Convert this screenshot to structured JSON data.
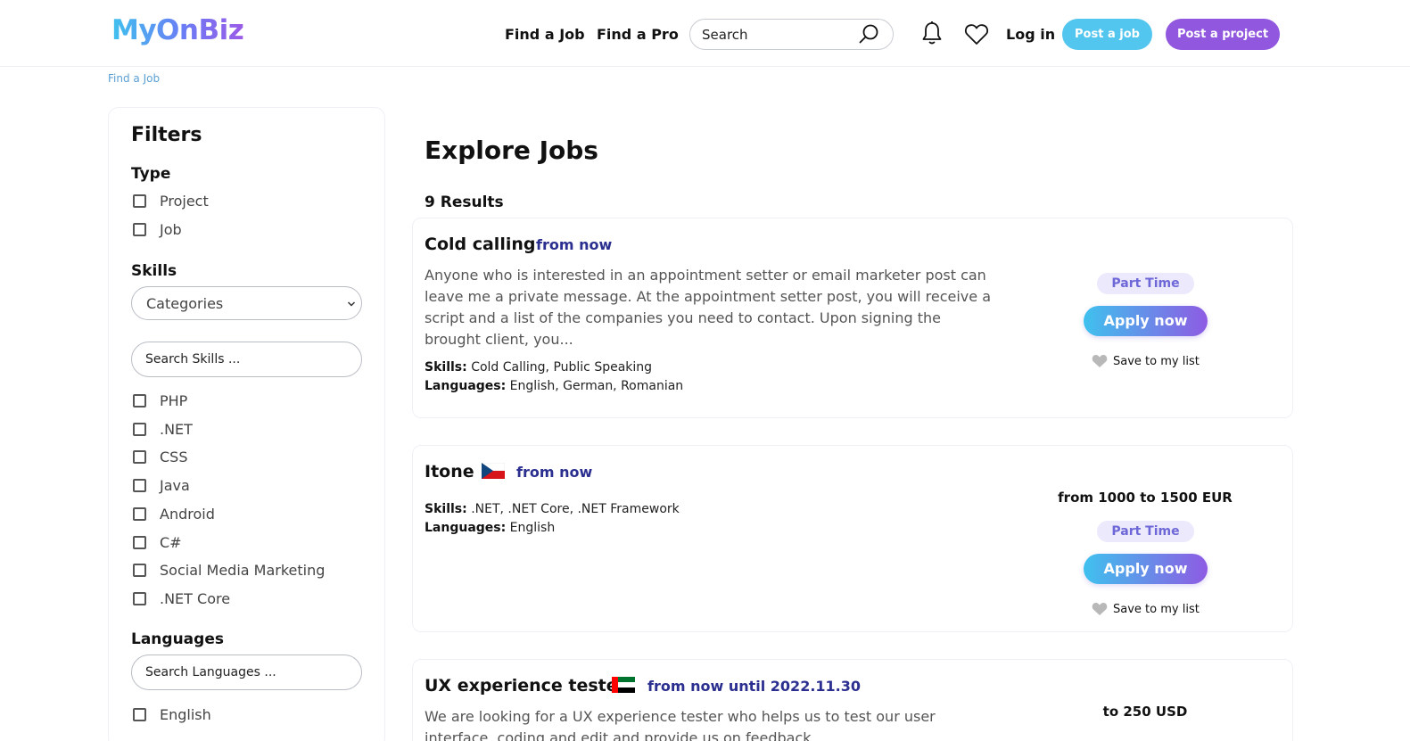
{
  "header": {
    "logo": "MyOnBiz",
    "nav": [
      "Find a Job",
      "Find a Pro"
    ],
    "search_placeholder": "Search",
    "login": "Log in",
    "post_job": "Post a job",
    "post_project": "Post a project"
  },
  "breadcrumb": "Find a Job",
  "filters": {
    "title": "Filters",
    "type_title": "Type",
    "types": [
      "Project",
      "Job"
    ],
    "skills_title": "Skills",
    "categories_select": "Categories",
    "skills_search_placeholder": "Search Skills ...",
    "skills": [
      "PHP",
      ".NET",
      "CSS",
      "Java",
      "Android",
      "C#",
      "Social Media Marketing",
      ".NET Core"
    ],
    "languages_title": "Languages",
    "languages_search_placeholder": "Search Languages ...",
    "languages": [
      "English"
    ]
  },
  "main": {
    "title": "Explore Jobs",
    "results": "9 Results",
    "skills_label": "Skills:",
    "languages_label": "Languages:",
    "apply_label": "Apply now",
    "save_label": "Save to my list",
    "jobs": [
      {
        "title": "Cold calling",
        "date": "from now",
        "description": "Anyone who is interested in an appointment setter or email marketer post can leave me a private message. At the appointment setter post, you will receive a script and a list of the companies you need to contact. Upon signing the brought client, you...",
        "skills": "Cold Calling, Public Speaking",
        "languages": "English, German, Romanian",
        "type": "Part Time"
      },
      {
        "title": "Itone",
        "flag": "czech-flag",
        "date": "from now",
        "skills": ".NET, .NET Core, .NET Framework",
        "languages": "English",
        "price": "from 1000 to 1500 EUR",
        "type": "Part Time"
      },
      {
        "title": "UX experience tester",
        "flag": "uae-flag",
        "date": "from now until 2022.11.30",
        "description": "We are looking for a UX experience tester who helps us to test our user interface, coding and edit and provide us on feedback...",
        "price": "to 250 USD"
      }
    ]
  },
  "colors": {
    "accent_blue": "#53c6ef",
    "accent_purple": "#9157de",
    "date_color": "#2b2f8f",
    "badge_text": "#6e67d8"
  }
}
